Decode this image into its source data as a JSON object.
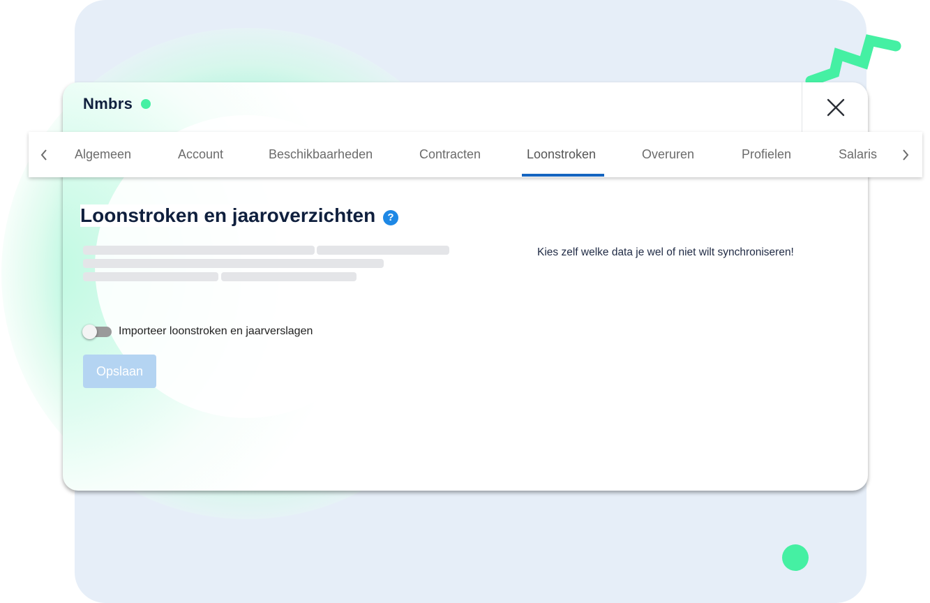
{
  "colors": {
    "accent": "#1565c0",
    "brand_green": "#45f0a3",
    "backdrop": "#e6eef8",
    "title": "#0f1f3d",
    "save_button_disabled": "#b4d4f2"
  },
  "app": {
    "name": "Nmbrs",
    "status_icon": "green-dot"
  },
  "header": {
    "close_icon": "close-x-icon"
  },
  "tabs": {
    "prev_icon": "chevron-left-icon",
    "next_icon": "chevron-right-icon",
    "active": "Loonstroken",
    "items": [
      {
        "label": "Algemeen"
      },
      {
        "label": "Account"
      },
      {
        "label": "Beschikbaarheden"
      },
      {
        "label": "Contracten"
      },
      {
        "label": "Loonstroken"
      },
      {
        "label": "Overuren"
      },
      {
        "label": "Profielen"
      },
      {
        "label": "Salaris"
      }
    ]
  },
  "main": {
    "title": "Loonstroken en jaaroverzichten",
    "help_icon": "question-mark-icon",
    "help_symbol": "?",
    "hint": "Kies zelf welke data je wel of niet wilt synchroniseren!",
    "toggle": {
      "label": "Importeer loonstroken en jaarverslagen",
      "on": false
    },
    "save_label": "Opslaan",
    "save_enabled": false
  }
}
